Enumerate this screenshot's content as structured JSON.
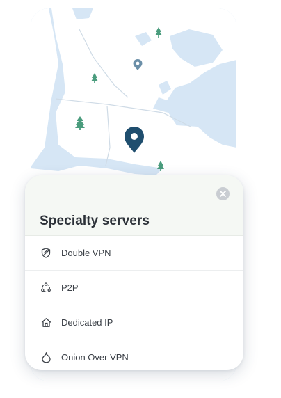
{
  "panel": {
    "title": "Specialty servers",
    "items": [
      {
        "label": "Double VPN",
        "icon": "shield-icon"
      },
      {
        "label": "P2P",
        "icon": "p2p-icon"
      },
      {
        "label": "Dedicated IP",
        "icon": "home-icon"
      },
      {
        "label": "Onion Over VPN",
        "icon": "onion-icon"
      }
    ]
  },
  "map": {
    "land_color": "#ffffff",
    "water_color": "#d6e6f5",
    "marker_color": "#1f4e6e",
    "secondary_marker_color": "#6b8fa8",
    "tree_color": "#4a9c7d"
  },
  "colors": {
    "header_bg": "#f5f8f4",
    "close_button": "#c9cdd2",
    "title_text": "#2c3138",
    "item_text": "#3b4047"
  }
}
